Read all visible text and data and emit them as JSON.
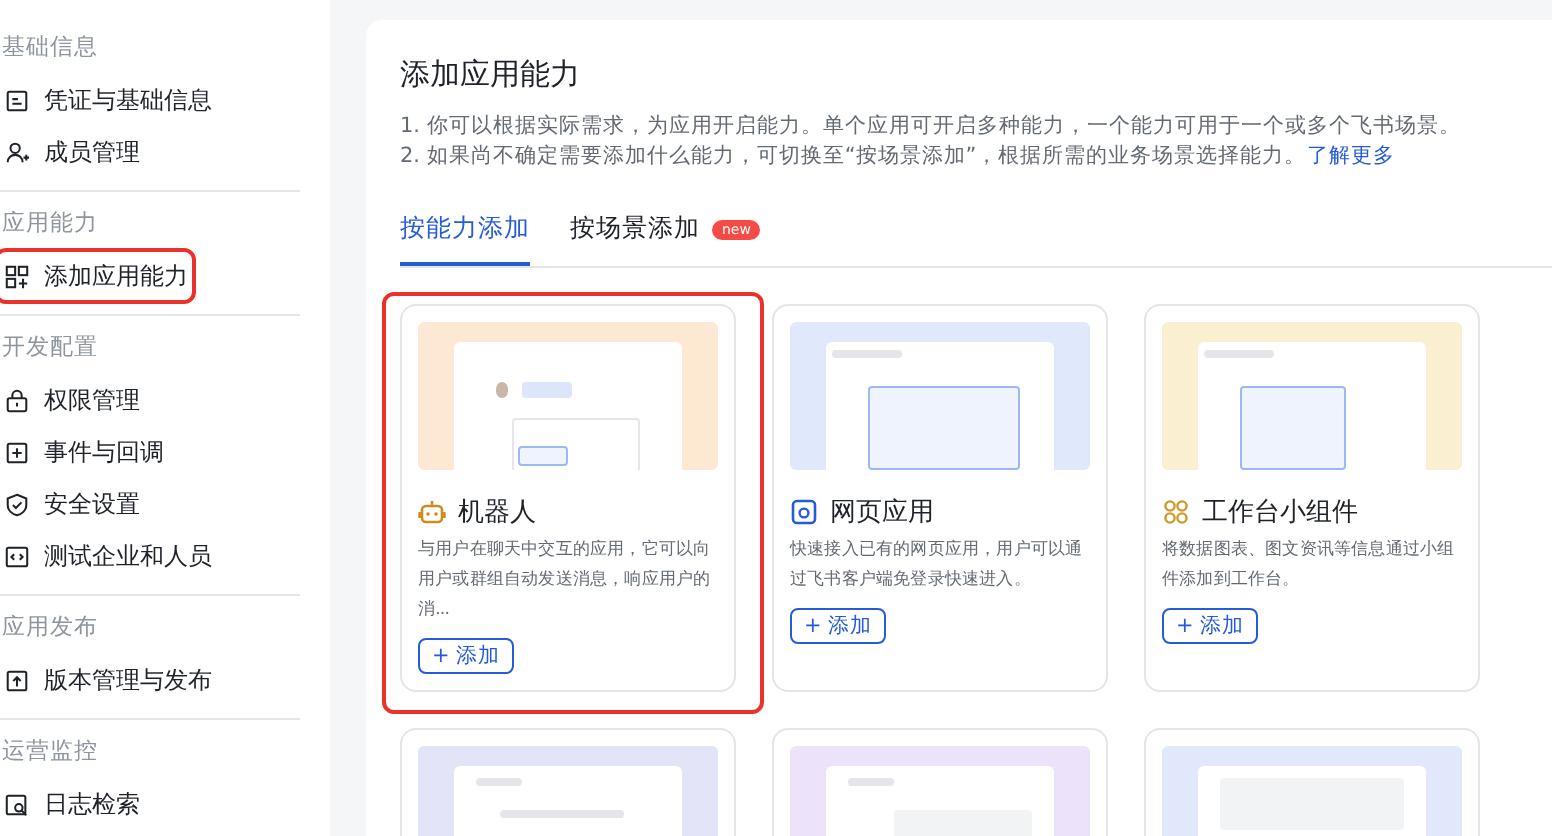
{
  "sidebar": {
    "sections": [
      {
        "title": "基础信息",
        "items": [
          {
            "label": "凭证与基础信息",
            "highlighted": false
          },
          {
            "label": "成员管理",
            "highlighted": false
          }
        ]
      },
      {
        "title": "应用能力",
        "items": [
          {
            "label": "添加应用能力",
            "highlighted": true
          }
        ]
      },
      {
        "title": "开发配置",
        "items": [
          {
            "label": "权限管理",
            "highlighted": false
          },
          {
            "label": "事件与回调",
            "highlighted": false
          },
          {
            "label": "安全设置",
            "highlighted": false
          },
          {
            "label": "测试企业和人员",
            "highlighted": false
          }
        ]
      },
      {
        "title": "应用发布",
        "items": [
          {
            "label": "版本管理与发布",
            "highlighted": false
          }
        ]
      },
      {
        "title": "运营监控",
        "items": [
          {
            "label": "日志检索",
            "highlighted": false
          }
        ]
      }
    ]
  },
  "main": {
    "title": "添加应用能力",
    "notes": [
      "1. 你可以根据实际需求，为应用开启能力。单个应用可开启多种能力，一个能力可用于一个或多个飞书场景。",
      "2. 如果尚不确定需要添加什么能力，可切换至“按场景添加”，根据所需的业务场景选择能力。"
    ],
    "learn_more": "了解更多",
    "tabs": [
      {
        "label": "按能力添加",
        "selected": true
      },
      {
        "label": "按场景添加",
        "selected": false,
        "badge": "new"
      }
    ],
    "cards": [
      {
        "title": "机器人",
        "description": "与用户在聊天中交互的应用，它可以向用户或群组自动发送消息，响应用户的消...",
        "button": "+ 添加",
        "highlighted": true
      },
      {
        "title": "网页应用",
        "description": "快速接入已有的网页应用，用户可以通过飞书客户端免登录快速进入。",
        "button": "+ 添加",
        "highlighted": false
      },
      {
        "title": "工作台小组件",
        "description": "将数据图表、图文资讯等信息通过小组件添加到工作台。",
        "button": "+ 添加",
        "highlighted": false
      },
      {
        "highlighted": false
      },
      {
        "highlighted": false
      },
      {
        "highlighted": false
      }
    ]
  }
}
